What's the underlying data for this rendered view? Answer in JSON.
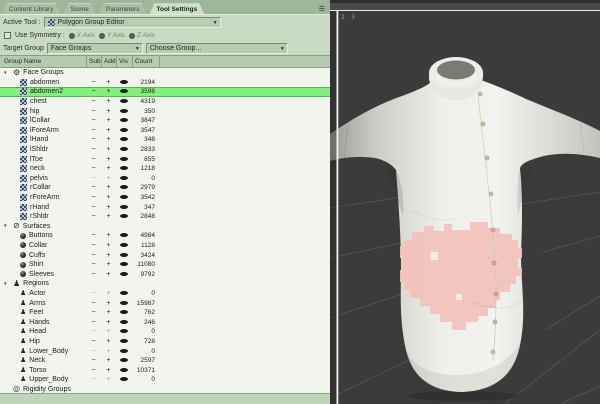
{
  "tabs": {
    "items": [
      {
        "label": "Content Library",
        "active": false
      },
      {
        "label": "Scene",
        "active": false
      },
      {
        "label": "Parameters",
        "active": false
      },
      {
        "label": "Tool Settings",
        "active": true
      }
    ]
  },
  "toolbar": {
    "active_tool_label": "Active Tool :",
    "active_tool_value": "Polygon Group Editor",
    "symmetry_label": "Use Symmetry :",
    "axes": [
      "X Axis",
      "Y Axis",
      "Z Axis"
    ],
    "target_group_label": "Target Group",
    "target_group_value": "Face Groups",
    "choose_group_value": "Choose Group..."
  },
  "columns": {
    "name": "Group Name",
    "sub": "Sub",
    "add": "Add",
    "vis": "Vis",
    "count": "Count"
  },
  "icons": {
    "chevron": "▼",
    "expand": "▾",
    "menu": "☰",
    "gear": "⚙",
    "surfaces_root": "⊘",
    "regions_root": "♟",
    "region_item": "♟",
    "rigidity": "◎",
    "sub": "−",
    "add": "+"
  },
  "tree": {
    "selected": "abdomen2",
    "sections": [
      {
        "label": "Face Groups",
        "root_icon": "gear",
        "root_icon_name": "face-groups-icon",
        "item_icon": "checker",
        "expanded": true,
        "items": [
          {
            "name": "abdomen",
            "count": 2194
          },
          {
            "name": "abdomen2",
            "count": 3598
          },
          {
            "name": "chest",
            "count": 4319
          },
          {
            "name": "hip",
            "count": 350
          },
          {
            "name": "lCollar",
            "count": 3847
          },
          {
            "name": "lForeArm",
            "count": 3547
          },
          {
            "name": "lHand",
            "count": 348
          },
          {
            "name": "lShldr",
            "count": 2833
          },
          {
            "name": "lToe",
            "count": 855
          },
          {
            "name": "neck",
            "count": 1218
          },
          {
            "name": "pelvis",
            "count": 0
          },
          {
            "name": "rCollar",
            "count": 2979
          },
          {
            "name": "rForeArm",
            "count": 3542
          },
          {
            "name": "rHand",
            "count": 347
          },
          {
            "name": "rShldr",
            "count": 2848
          }
        ]
      },
      {
        "label": "Surfaces",
        "root_icon": "surfaces_root",
        "root_icon_name": "surfaces-icon",
        "item_icon": "sphere",
        "expanded": true,
        "items": [
          {
            "name": "Buttons",
            "count": 4984
          },
          {
            "name": "Collar",
            "count": 1128
          },
          {
            "name": "Cuffs",
            "count": 3424
          },
          {
            "name": "Shirt",
            "count": 11080
          },
          {
            "name": "Sleeves",
            "count": 9792
          }
        ]
      },
      {
        "label": "Regions",
        "root_icon": "regions_root",
        "root_icon_name": "regions-icon",
        "item_icon": "region",
        "expanded": true,
        "items": [
          {
            "name": "Actor",
            "count": 0
          },
          {
            "name": "Arms",
            "count": 15987
          },
          {
            "name": "Feet",
            "count": 762
          },
          {
            "name": "Hands",
            "count": 246
          },
          {
            "name": "Head",
            "count": 0
          },
          {
            "name": "Hip",
            "count": 728
          },
          {
            "name": "Lower_Body",
            "count": 0
          },
          {
            "name": "Neck",
            "count": 2597
          },
          {
            "name": "Torso",
            "count": 10371
          },
          {
            "name": "Upper_Body",
            "count": 0
          }
        ]
      },
      {
        "label": "Rigidity Groups",
        "root_icon": "rigidity",
        "root_icon_name": "rigidity-groups-icon",
        "item_icon": "",
        "expanded": false,
        "items": []
      }
    ]
  },
  "viewport": {
    "pane_label": "2 3"
  },
  "colors": {
    "selection_green": "#84ef7c",
    "panel_green": "#c9dac3",
    "viewport_bg": "#3b3b3c",
    "paint_pink": "#f2c3ba"
  }
}
